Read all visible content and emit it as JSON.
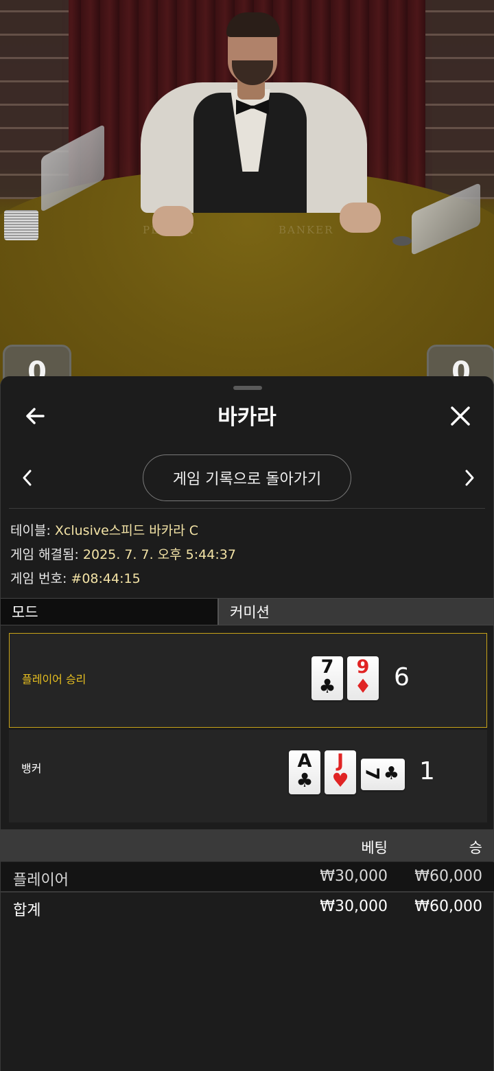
{
  "video": {
    "felt_left_text": "PLAYER",
    "felt_right_text": "BANKER",
    "player_score_tab": "0",
    "banker_score_tab": "0"
  },
  "panel": {
    "title": "바카라",
    "back_icon": "arrow-left-icon",
    "close_icon": "close-x-icon",
    "prev_icon": "chevron-left-icon",
    "next_icon": "chevron-right-icon",
    "history_button": "게임 기록으로 돌아가기"
  },
  "info": {
    "table_label": "테이블:",
    "table_value": "Xclusive스피드 바카라 C",
    "resolved_label": "게임 해결됨:",
    "resolved_value": "2025. 7. 7. 오후 5:44:37",
    "number_label": "게임 번호:",
    "number_value": "#08:44:15"
  },
  "tabs": {
    "mode": "모드",
    "commission": "커미션"
  },
  "results": {
    "player": {
      "label": "플레이어 승리",
      "cards": [
        {
          "rank": "7",
          "suit": "♣",
          "color": "black"
        },
        {
          "rank": "9",
          "suit": "♦",
          "color": "red"
        }
      ],
      "score": "6",
      "highlight_color": "#c9a418"
    },
    "banker": {
      "label": "뱅커",
      "cards": [
        {
          "rank": "A",
          "suit": "♣",
          "color": "black"
        },
        {
          "rank": "J",
          "suit": "♥",
          "color": "red"
        },
        {
          "rank": "7",
          "suit": "♣",
          "color": "black",
          "rotated": true
        }
      ],
      "score": "1"
    }
  },
  "bets": {
    "col_bet": "베팅",
    "col_win": "승",
    "rows": [
      {
        "name": "플레이어",
        "bet": "₩30,000",
        "win": "₩60,000"
      }
    ],
    "total": {
      "name": "합계",
      "bet": "₩30,000",
      "win": "₩60,000"
    }
  }
}
